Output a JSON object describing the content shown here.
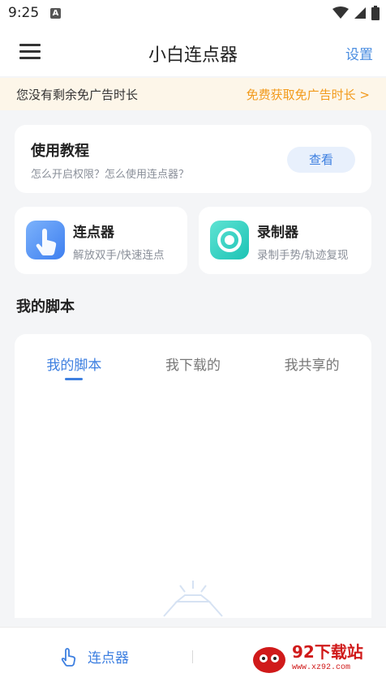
{
  "status_bar": {
    "time": "9:25",
    "notification_badge": "A",
    "icons": [
      "wifi-icon",
      "signal-icon",
      "battery-icon"
    ]
  },
  "app_bar": {
    "menu_icon": "hamburger-menu-icon",
    "title": "小白连点器",
    "settings_label": "设置"
  },
  "ad_banner": {
    "message": "您没有剩余免广告时长",
    "action": "免费获取免广告时长 >"
  },
  "tutorial": {
    "title": "使用教程",
    "subtitle": "怎么开启权限？怎么使用连点器？",
    "button": "查看"
  },
  "features": [
    {
      "title": "连点器",
      "subtitle": "解放双手/快速连点",
      "icon": "tap-hand-icon"
    },
    {
      "title": "录制器",
      "subtitle": "录制手势/轨迹复现",
      "icon": "record-icon"
    }
  ],
  "my_scripts": {
    "section_title": "我的脚本",
    "tabs": [
      {
        "label": "我的脚本",
        "active": true
      },
      {
        "label": "我下载的",
        "active": false
      },
      {
        "label": "我共享的",
        "active": false
      }
    ]
  },
  "bottom_nav": {
    "item_label": "连点器",
    "item_icon": "tap-hand-icon"
  },
  "watermark": {
    "title": "92下载站",
    "url": "www.xz92.com"
  },
  "colors": {
    "accent": "#3d7fe0",
    "settings": "#4a8de0",
    "ad_link": "#f29a1b",
    "ad_bg": "#fdf6e9"
  }
}
